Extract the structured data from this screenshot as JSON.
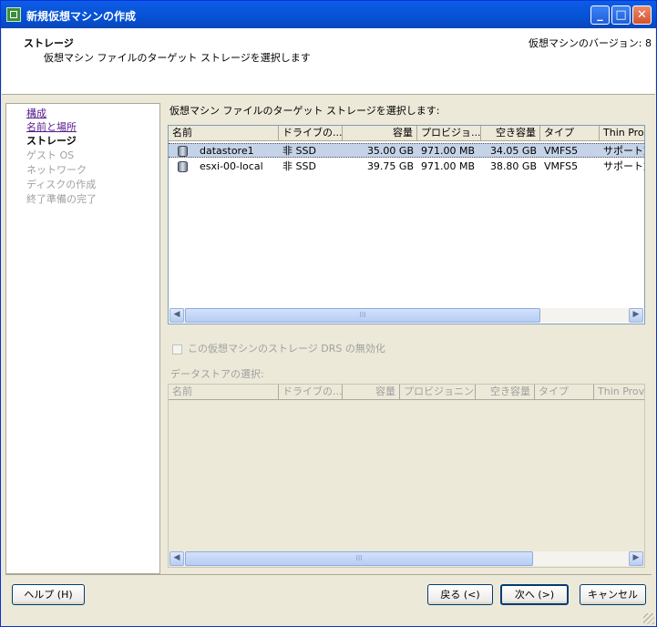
{
  "window": {
    "title": "新規仮想マシンの作成"
  },
  "header": {
    "title": "ストレージ",
    "subtitle": "仮想マシン ファイルのターゲット ストレージを選択します",
    "version": "仮想マシンのバージョン: 8"
  },
  "nav": {
    "items": [
      {
        "label": "構成",
        "state": "link"
      },
      {
        "label": "名前と場所",
        "state": "link"
      },
      {
        "label": "ストレージ",
        "state": "current"
      },
      {
        "label": "ゲスト OS",
        "state": "disabled"
      },
      {
        "label": "ネットワーク",
        "state": "disabled"
      },
      {
        "label": "ディスクの作成",
        "state": "disabled"
      },
      {
        "label": "終了準備の完了",
        "state": "disabled"
      }
    ]
  },
  "main": {
    "section_label": "仮想マシン ファイルのターゲット ストレージを選択します:",
    "columns": [
      "名前",
      "ドライブの...",
      "容量",
      "プロビジョ...",
      "空き容量",
      "タイプ",
      "Thin Prov"
    ],
    "rows": [
      {
        "name": "datastore1",
        "drive": "非 SSD",
        "capacity": "35.00 GB",
        "provisioned": "971.00 MB",
        "free": "34.05 GB",
        "type": "VMFS5",
        "thin": "サポート対"
      },
      {
        "name": "esxi-00-local",
        "drive": "非 SSD",
        "capacity": "39.75 GB",
        "provisioned": "971.00 MB",
        "free": "38.80 GB",
        "type": "VMFS5",
        "thin": "サポート対"
      }
    ],
    "drs_checkbox": "この仮想マシンのストレージ DRS の無効化",
    "datastore_label": "データストアの選択:",
    "ds_columns": [
      "名前",
      "ドライブの...",
      "容量",
      "プロビジョニン...",
      "空き容量",
      "タイプ",
      "Thin Provi"
    ],
    "scroll_grip": "III"
  },
  "footer": {
    "help": "ヘルプ (H)",
    "back": "戻る (<)",
    "next": "次へ (>)",
    "cancel": "キャンセル"
  },
  "colors": {
    "titlebar": "#0550d0",
    "selection": "#c5d3e8"
  }
}
